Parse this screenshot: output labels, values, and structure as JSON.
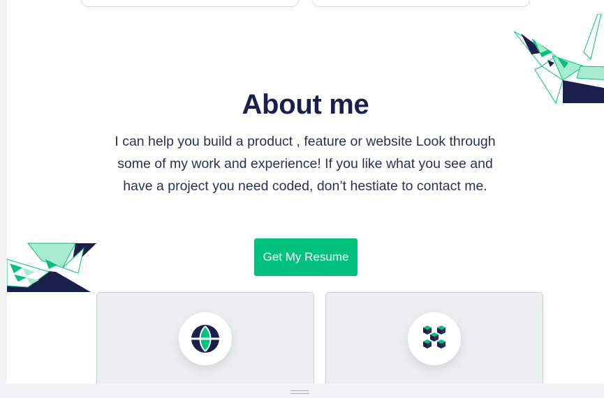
{
  "about": {
    "title": "About me",
    "description": "I can help you build a product , feature or website Look through some of my work and experience! If you like what you see and have a project you need coded, don’t hestiate to contact me.",
    "resume_button_label": "Get My Resume"
  },
  "colors": {
    "accent": "#00c27c",
    "navy": "#1b1f4b",
    "mint": "#a8ecd0"
  },
  "services": [
    {
      "icon": "globe-icon"
    },
    {
      "icon": "blocks-icon"
    }
  ]
}
